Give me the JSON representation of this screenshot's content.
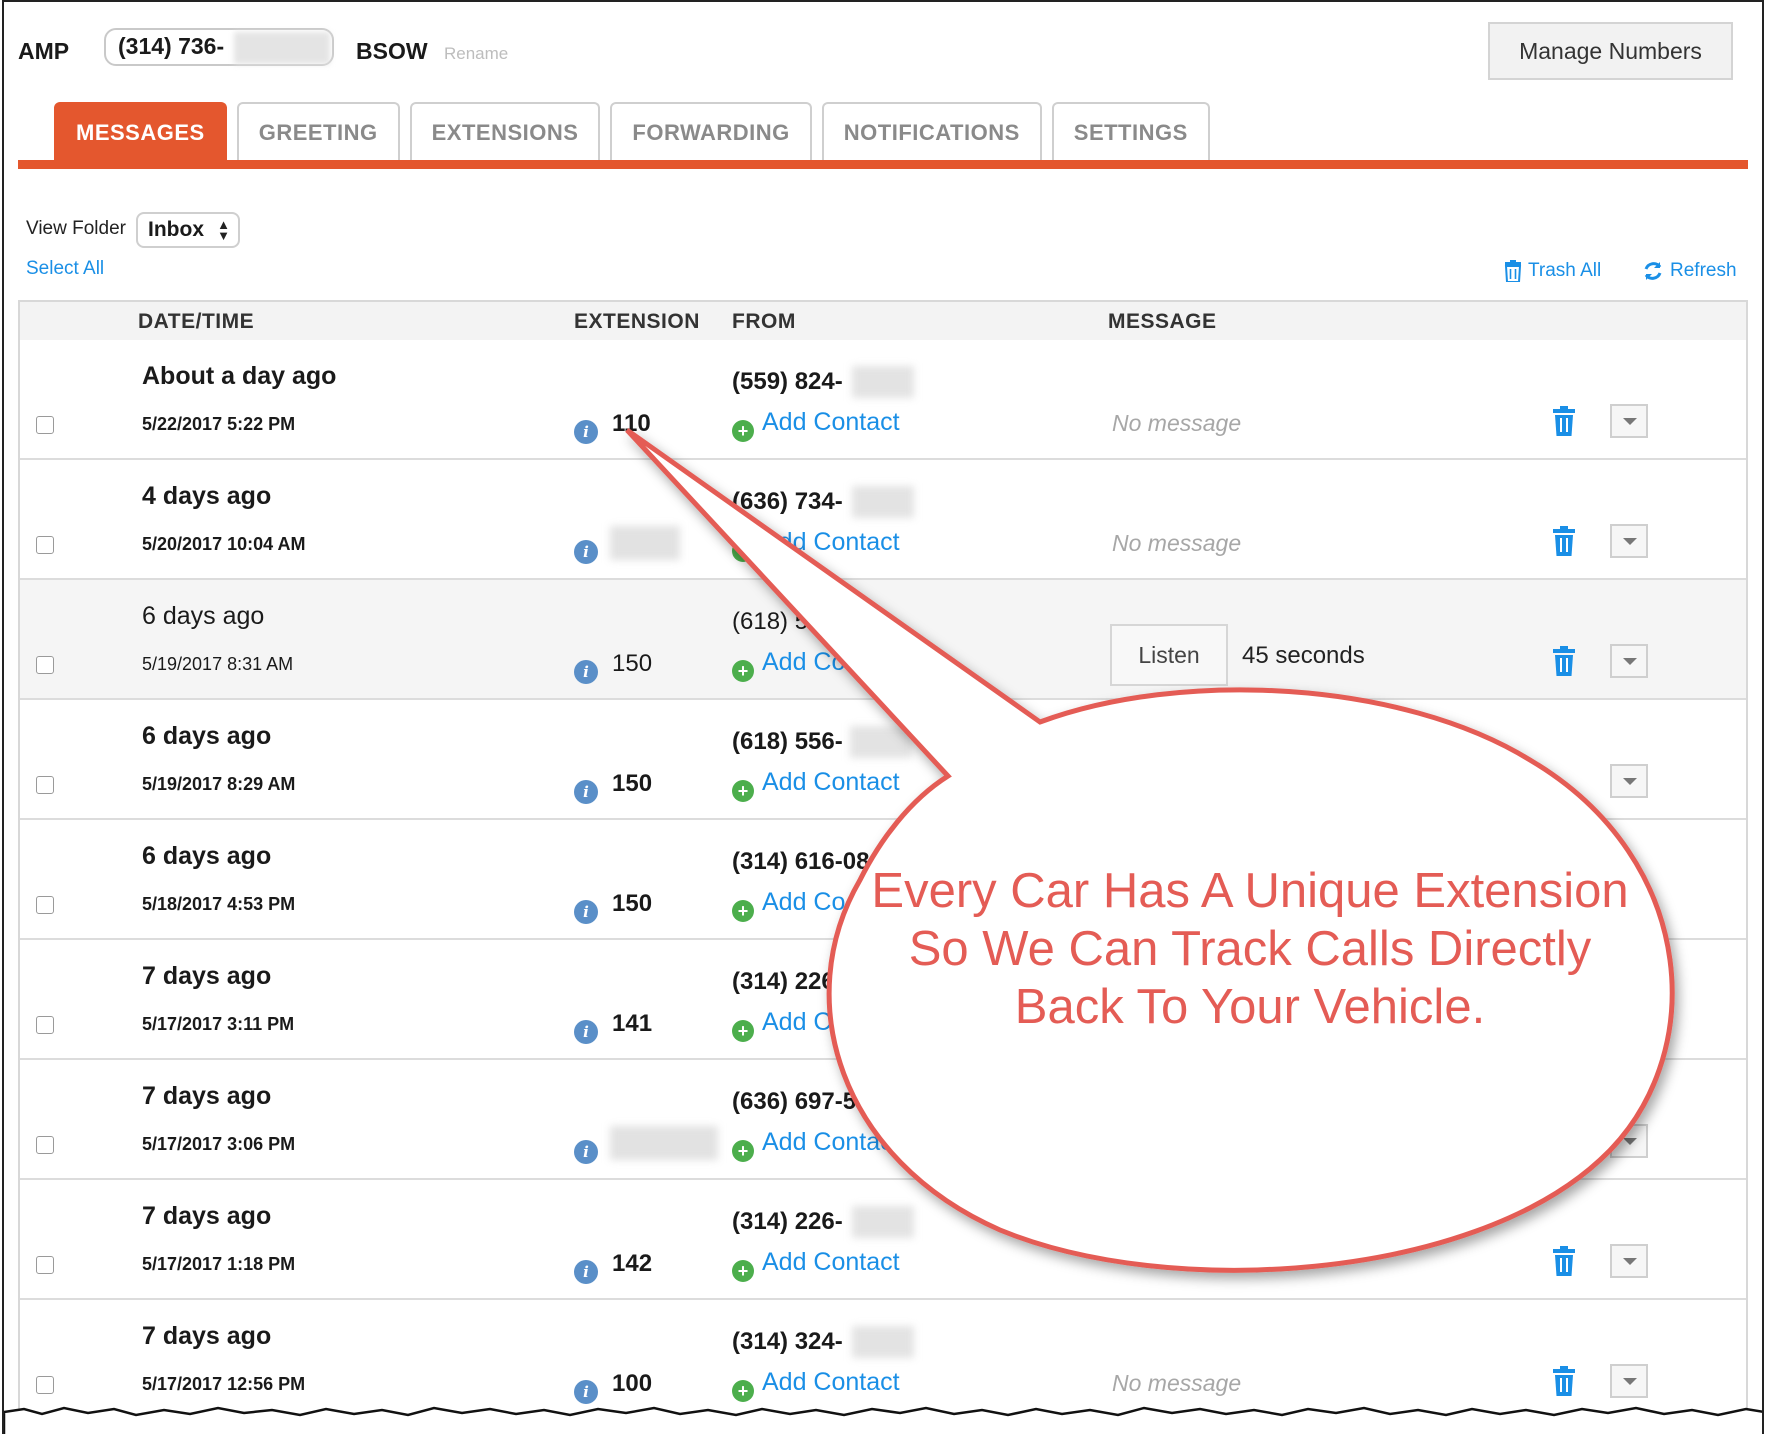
{
  "header": {
    "account": "AMP",
    "number": "(314) 736-",
    "name": "BSOW",
    "rename": "Rename",
    "manage_button": "Manage Numbers"
  },
  "tabs": [
    "MESSAGES",
    "GREETING",
    "EXTENSIONS",
    "FORWARDING",
    "NOTIFICATIONS",
    "SETTINGS"
  ],
  "active_tab": "MESSAGES",
  "folder": {
    "label": "View Folder",
    "selected": "Inbox",
    "select_all": "Select All",
    "trash_all": "Trash All",
    "refresh": "Refresh"
  },
  "columns": [
    "DATE/TIME",
    "EXTENSION",
    "FROM",
    "MESSAGE"
  ],
  "rows": [
    {
      "relative": "About a day ago",
      "datetime": "5/22/2017 5:22 PM",
      "extension": "110",
      "from": "(559) 824-",
      "add_contact": "Add Contact",
      "message": "No message",
      "bold": true
    },
    {
      "relative": "4 days ago",
      "datetime": "5/20/2017 10:04 AM",
      "extension": "",
      "from": "(636) 734-",
      "add_contact": "Add Contact",
      "message": "No message",
      "bold": true
    },
    {
      "relative": "6 days ago",
      "datetime": "5/19/2017 8:31 AM",
      "extension": "150",
      "from": "(618) 5",
      "add_contact": "Add Co",
      "listen": "Listen",
      "duration": "45 seconds",
      "bold": false
    },
    {
      "relative": "6 days ago",
      "datetime": "5/19/2017 8:29 AM",
      "extension": "150",
      "from": "(618) 556-",
      "add_contact": "Add Contact",
      "message": "",
      "bold": true
    },
    {
      "relative": "6 days ago",
      "datetime": "5/18/2017 4:53 PM",
      "extension": "150",
      "from": "(314) 616-08",
      "add_contact": "Add Co",
      "message": "",
      "bold": true
    },
    {
      "relative": "7 days ago",
      "datetime": "5/17/2017 3:11 PM",
      "extension": "141",
      "from": "(314) 226",
      "add_contact": "Add Co",
      "message": "",
      "bold": true
    },
    {
      "relative": "7 days ago",
      "datetime": "5/17/2017 3:06 PM",
      "extension": "",
      "from": "(636) 697-57",
      "add_contact": "Add Contact",
      "message": "",
      "bold": true
    },
    {
      "relative": "7 days ago",
      "datetime": "5/17/2017 1:18 PM",
      "extension": "142",
      "from": "(314) 226-",
      "add_contact": "Add Contact",
      "message": "",
      "bold": true
    },
    {
      "relative": "7 days ago",
      "datetime": "5/17/2017 12:56 PM",
      "extension": "100",
      "from": "(314) 324-",
      "add_contact": "Add Contact",
      "message": "No message",
      "bold": true
    }
  ],
  "callout": {
    "text": "Every Car Has A Unique Extension So We Can Track Calls Directly Back To Your Vehicle."
  },
  "colors": {
    "accent": "#e4572e",
    "link": "#1a8fe6",
    "callout": "#e45c55"
  }
}
